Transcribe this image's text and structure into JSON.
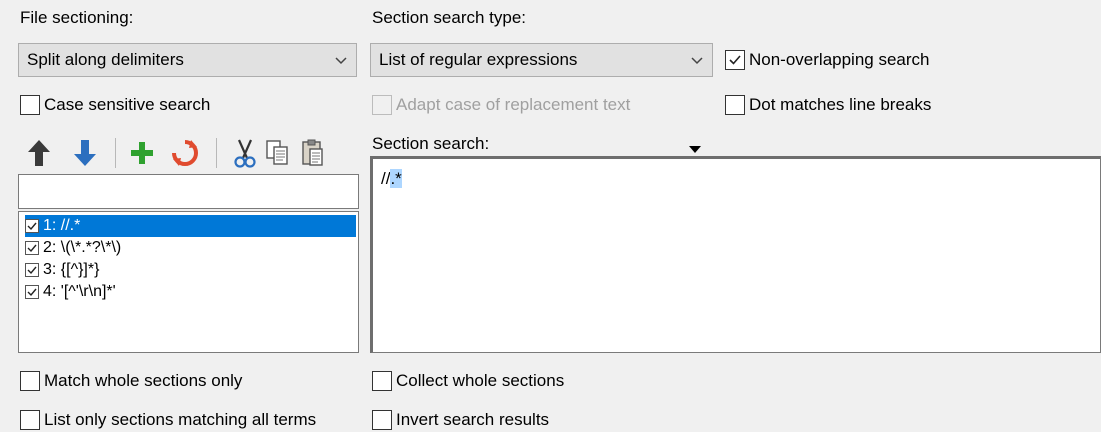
{
  "file_sectioning": {
    "label": "File sectioning:",
    "value": "Split along delimiters"
  },
  "section_search_type": {
    "label": "Section search type:",
    "value": "List of regular expressions"
  },
  "options": {
    "non_overlapping": {
      "label": "Non-overlapping search",
      "checked": true
    },
    "case_sensitive": {
      "label": "Case sensitive search",
      "checked": false
    },
    "adapt_case": {
      "label": "Adapt case of replacement text",
      "checked": false,
      "disabled": true
    },
    "dot_matches": {
      "label": "Dot matches line breaks",
      "checked": false
    },
    "match_whole": {
      "label": "Match whole sections only",
      "checked": false
    },
    "collect_whole": {
      "label": "Collect whole sections",
      "checked": false
    },
    "list_all_terms": {
      "label": "List only sections matching all terms",
      "checked": false
    },
    "invert": {
      "label": "Invert search results",
      "checked": false
    }
  },
  "section_search": {
    "label": "Section search:",
    "text_plain": "//",
    "text_selected": ".*"
  },
  "term_list": {
    "filter_value": "",
    "items": [
      {
        "label": "1: //.*",
        "checked": true,
        "selected": true
      },
      {
        "label": "2: \\(\\*.*?\\*\\)",
        "checked": true,
        "selected": false
      },
      {
        "label": "3: {[^}]*}",
        "checked": true,
        "selected": false
      },
      {
        "label": "4: '[^'\\r\\n]*'",
        "checked": true,
        "selected": false
      }
    ]
  },
  "toolbar": {
    "icons": [
      "arrow-up-icon",
      "arrow-down-icon",
      "plus-icon",
      "recycle-icon",
      "scissors-icon",
      "copy-icon",
      "paste-icon"
    ]
  },
  "colors": {
    "selection": "#0078d7",
    "arrow_up": "#3a3a3a",
    "arrow_down": "#2c6fbf",
    "plus": "#2fa12f",
    "recycle": "#e04b2f",
    "highlight": "#add6ff"
  }
}
